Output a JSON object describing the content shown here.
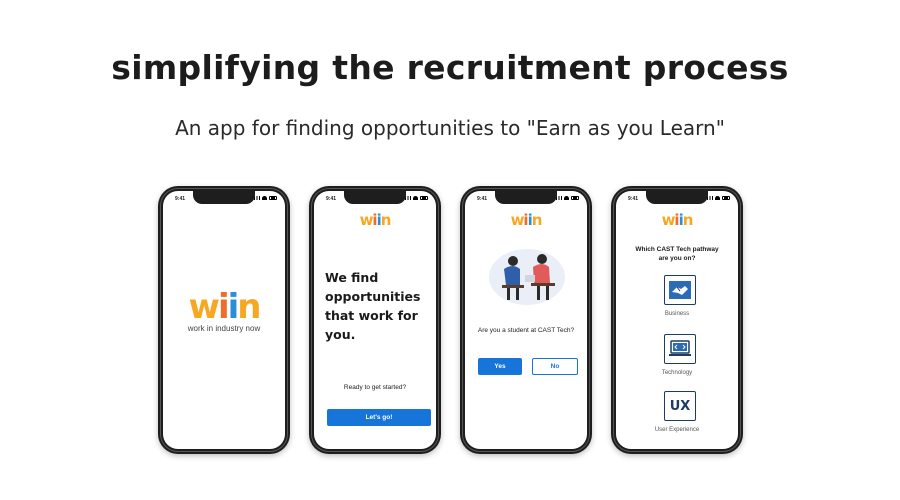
{
  "headline": "simplifying the recruitment process",
  "subheadline": "An app for finding opportunities to \"Earn as you Learn\"",
  "status_time": "9:41",
  "logo": {
    "l1": "w",
    "l2": "i",
    "l3": "i",
    "l4": "n"
  },
  "colors": {
    "orange": "#f7a823",
    "red_orange": "#ef6c2a",
    "blue": "#2b8fd8",
    "button_blue": "#1774d8",
    "navy": "#1d3b63"
  },
  "screen1": {
    "tagline": "work in industry now"
  },
  "screen2": {
    "hero_line1": "We find",
    "hero_line2": "opportunities",
    "hero_line3": "that work for",
    "hero_line4": "you.",
    "ready_text": "Ready to get started?",
    "cta_label": "Let's go!"
  },
  "screen3": {
    "question": "Are you a student at CAST Tech?",
    "yes_label": "Yes",
    "no_label": "No"
  },
  "screen4": {
    "question_line1": "Which CAST Tech pathway",
    "question_line2": "are you on?",
    "pathways": [
      {
        "label": "Business",
        "icon": "handshake-icon"
      },
      {
        "label": "Technology",
        "icon": "laptop-code-icon"
      },
      {
        "label": "User Experience",
        "icon": "ux-icon",
        "icon_text": "UX"
      }
    ]
  }
}
